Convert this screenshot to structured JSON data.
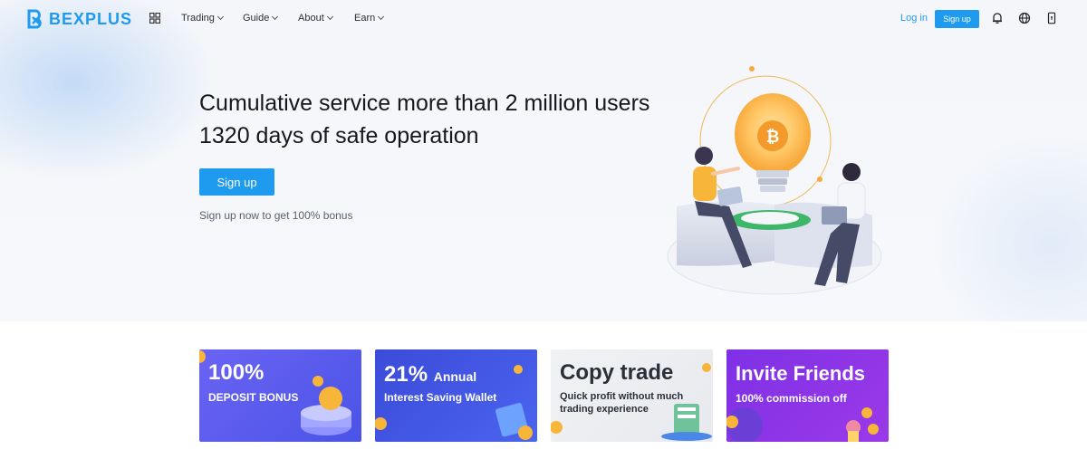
{
  "nav": {
    "logo_text": "BEXPLUS",
    "menu": [
      {
        "label": "Trading"
      },
      {
        "label": "Guide"
      },
      {
        "label": "About"
      },
      {
        "label": "Earn"
      }
    ],
    "login_label": "Log in",
    "signup_label": "Sign up",
    "icons": [
      "bell-icon",
      "globe-icon",
      "mobile-app-icon"
    ]
  },
  "hero": {
    "headline_line1": "Cumulative service more than 2 million users",
    "headline_line2": "1320 days of safe operation",
    "cta_label": "Sign up",
    "note": "Sign up now to get 100% bonus"
  },
  "cards": [
    {
      "title": "100%",
      "subtitle": "DEPOSIT BONUS"
    },
    {
      "title": "21%",
      "title_suffix": "Annual",
      "subtitle": "Interest Saving Wallet"
    },
    {
      "title": "Copy trade",
      "subtitle_line1": "Quick profit without much",
      "subtitle_line2": "trading experience"
    },
    {
      "title": "Invite Friends",
      "subtitle": "100% commission off"
    }
  ],
  "colors": {
    "brand": "#1e9bef",
    "card1": "#5b5ff0",
    "card2": "#3c55e6",
    "card3": "#eef0f3",
    "card4": "#7b35e8"
  }
}
